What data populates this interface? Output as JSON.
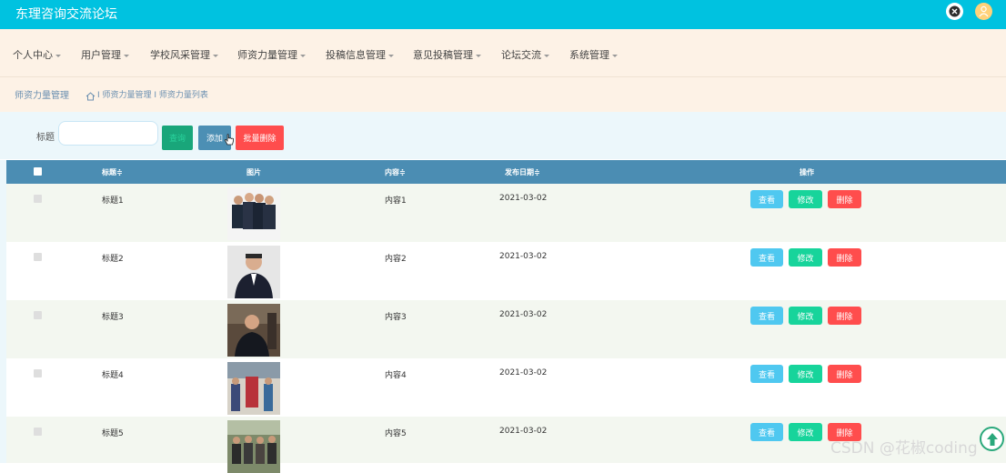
{
  "app": {
    "title": "东理咨询交流论坛"
  },
  "topbar": {
    "icons": [
      "close-icon",
      "user-avatar-icon"
    ]
  },
  "nav": [
    {
      "label": "个人中心"
    },
    {
      "label": "用户管理"
    },
    {
      "label": "学校风采管理"
    },
    {
      "label": "师资力量管理"
    },
    {
      "label": "投稿信息管理"
    },
    {
      "label": "意见投稿管理"
    },
    {
      "label": "论坛交流"
    },
    {
      "label": "系统管理"
    }
  ],
  "breadcrumb": {
    "title": "师资力量管理",
    "path": "I 师资力量管理 I 师资力量列表"
  },
  "search": {
    "label": "标题",
    "value": "",
    "placeholder": "",
    "search_btn": "查询",
    "add_btn": "添加",
    "batch_delete_btn": "批量删除"
  },
  "table": {
    "headers": {
      "title": "标题≑",
      "image": "图片",
      "content": "内容≑",
      "date": "发布日期≑",
      "actions": "操作"
    },
    "rows": [
      {
        "title": "标题1",
        "content": "内容1",
        "date": "2021-03-02"
      },
      {
        "title": "标题2",
        "content": "内容2",
        "date": "2021-03-02"
      },
      {
        "title": "标题3",
        "content": "内容3",
        "date": "2021-03-02"
      },
      {
        "title": "标题4",
        "content": "内容4",
        "date": "2021-03-02"
      },
      {
        "title": "标题5",
        "content": "内容5",
        "date": "2021-03-02"
      }
    ],
    "actions": {
      "view": "查看",
      "edit": "修改",
      "delete": "删除"
    }
  },
  "watermark": "CSDN @花椒coding",
  "colors": {
    "topbar": "#00c2e0",
    "nav_bg": "#fdf2e6",
    "table_header": "#4b8db3",
    "view": "#4fc8f0",
    "edit": "#17d49b",
    "delete": "#ff4d4d"
  }
}
